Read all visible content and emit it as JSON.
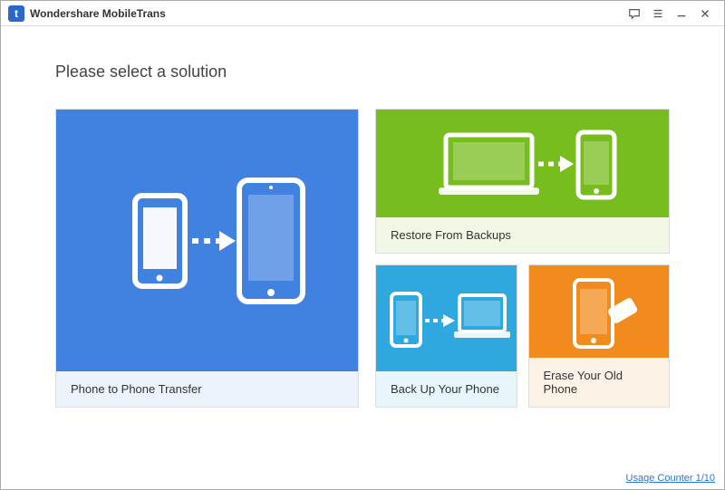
{
  "titlebar": {
    "app_name": "Wondershare MobileTrans"
  },
  "heading": "Please select a solution",
  "tiles": {
    "transfer": {
      "label": "Phone to Phone Transfer"
    },
    "restore": {
      "label": "Restore From Backups"
    },
    "backup": {
      "label": "Back Up Your Phone"
    },
    "erase": {
      "label": "Erase Your Old Phone"
    }
  },
  "footer": {
    "usage_counter": "Usage Counter 1/10"
  },
  "colors": {
    "blue": "#4182e0",
    "green": "#77bd1e",
    "cyan": "#2fa8e0",
    "orange": "#f28b1d"
  }
}
